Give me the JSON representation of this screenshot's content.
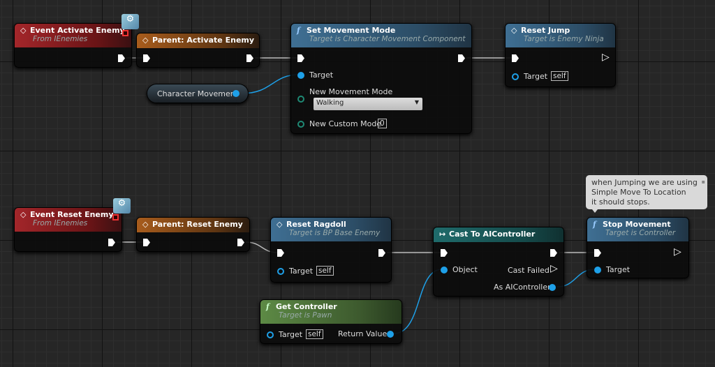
{
  "nodes": {
    "event_activate": {
      "title": "Event Activate Enemy",
      "subtitle": "From IEnemies"
    },
    "parent_activate": {
      "title": "Parent: Activate Enemy"
    },
    "character_movement": {
      "label": "Character Movement"
    },
    "set_movement_mode": {
      "title": "Set Movement Mode",
      "subtitle": "Target is Character Movement Component",
      "target": "Target",
      "new_mode_label": "New Movement Mode",
      "new_mode_value": "Walking",
      "custom_mode_label": "New Custom Mode",
      "custom_mode_value": "0"
    },
    "reset_jump": {
      "title": "Reset Jump",
      "subtitle": "Target is Enemy Ninja",
      "target": "Target",
      "target_value": "self"
    },
    "event_reset": {
      "title": "Event Reset Enemy",
      "subtitle": "From IEnemies"
    },
    "parent_reset": {
      "title": "Parent: Reset Enemy"
    },
    "reset_ragdoll": {
      "title": "Reset Ragdoll",
      "subtitle": "Target is BP Base Enemy",
      "target": "Target",
      "target_value": "self"
    },
    "get_controller": {
      "title": "Get Controller",
      "subtitle": "Target is Pawn",
      "target": "Target",
      "target_value": "self",
      "return_value": "Return Value"
    },
    "cast": {
      "title": "Cast To AIController",
      "object": "Object",
      "cast_failed": "Cast Failed",
      "as": "As AIController"
    },
    "stop_movement": {
      "title": "Stop Movement",
      "subtitle": "Target is Controller",
      "target": "Target"
    }
  },
  "comment": {
    "line1": "when Jumping we are using",
    "line2": "Simple Move To Location",
    "line3": "it should stops."
  },
  "colors": {
    "event": "#a3262a",
    "parent": "#a85c1c",
    "function": "#3f6f93",
    "cast": "#1f6b6b",
    "pure": "#5d8a45",
    "object_pin": "#1ea0e8"
  }
}
